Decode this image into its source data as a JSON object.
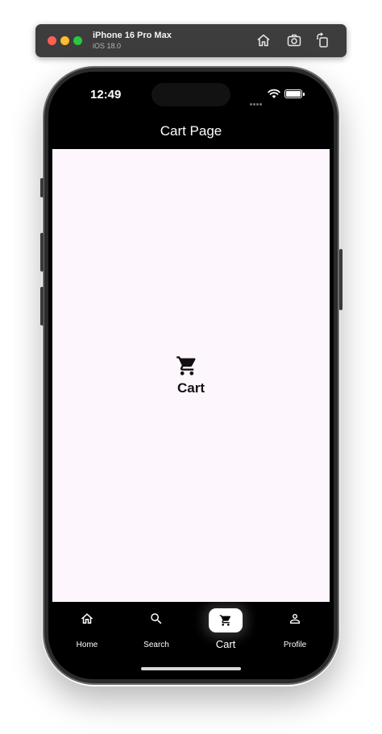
{
  "simulator": {
    "device_name": "iPhone 16 Pro Max",
    "os_version": "iOS 18.0",
    "toolbar": [
      "home-icon",
      "screenshot-icon",
      "rotate-icon"
    ]
  },
  "status_bar": {
    "time": "12:49"
  },
  "app_bar": {
    "title": "Cart Page"
  },
  "body": {
    "icon": "shopping-cart-icon",
    "label": "Cart"
  },
  "bottom_nav": {
    "items": [
      {
        "label": "Home",
        "icon": "home-icon",
        "active": false
      },
      {
        "label": "Search",
        "icon": "search-icon",
        "active": false
      },
      {
        "label": "Cart",
        "icon": "shopping-cart-icon",
        "active": true
      },
      {
        "label": "Profile",
        "icon": "person-icon",
        "active": false
      }
    ]
  },
  "colors": {
    "body_background": "#fdf6fd",
    "app_bar_background": "#000000",
    "nav_background": "#000000"
  }
}
